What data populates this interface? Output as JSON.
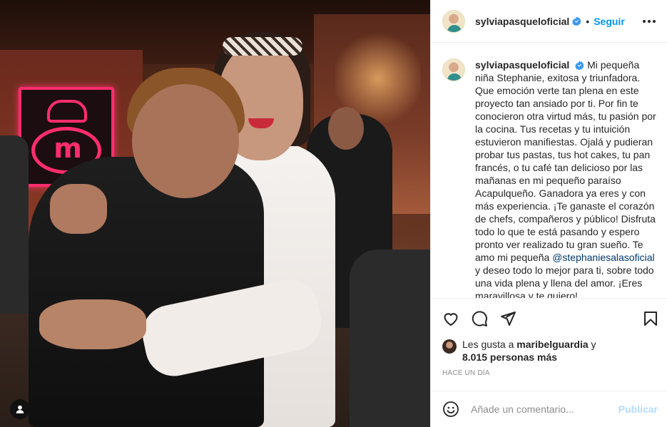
{
  "post": {
    "image_alt": "",
    "username": "sylviapasqueloficial",
    "follow_label": "Seguir",
    "separator": "•"
  },
  "caption": {
    "username": "sylviapasqueloficial",
    "text_part1": "Mi pequeña niña Stephanie, exitosa y triunfadora. Que emoción verte tan plena en este proyecto tan ansiado por ti. Por fin te conocieron otra virtud más, tu pasión por la cocina. Tus recetas y tu intuición estuvieron manifiestas. Ojalá y pudieran probar tus pastas, tus hot cakes, tu pan francés, o tu café tan delicioso por las mañanas en mi pequeño paraíso Acapulqueño. Ganadora ya eres y con más experiencia. ¡Te ganaste el corazón de chefs, compañeros y público! Disfruta todo lo que te está pasando y espero pronto ver realizado tu gran sueño. Te amo mi pequeña ",
    "mention": "@stephaniesalasoficial",
    "text_part2": " y deseo todo lo mejor para ti, sobre todo una vida plena y llena del amor. ¡Eres maravillosa y te quiero!"
  },
  "likes": {
    "prefix": "Les gusta a",
    "user": "maribelguardia",
    "conj": "y",
    "count": "8.015 personas más"
  },
  "timestamp": "HACE UN DÍA",
  "comment_box": {
    "placeholder": "Añade un comentario...",
    "publish_label": "Publicar"
  },
  "icons": {
    "verified": "verified-badge-icon",
    "more": "more-options-icon",
    "like": "heart-icon",
    "comment": "comment-icon",
    "share": "send-icon",
    "save": "bookmark-icon",
    "emoji": "emoji-icon",
    "tag": "user-tag-icon"
  },
  "colors": {
    "accent": "#0095f6",
    "publish_disabled": "#b3dbff",
    "mention": "#00376b",
    "muted": "#8e8e8e",
    "logo_pink": "#ff2d6d"
  }
}
